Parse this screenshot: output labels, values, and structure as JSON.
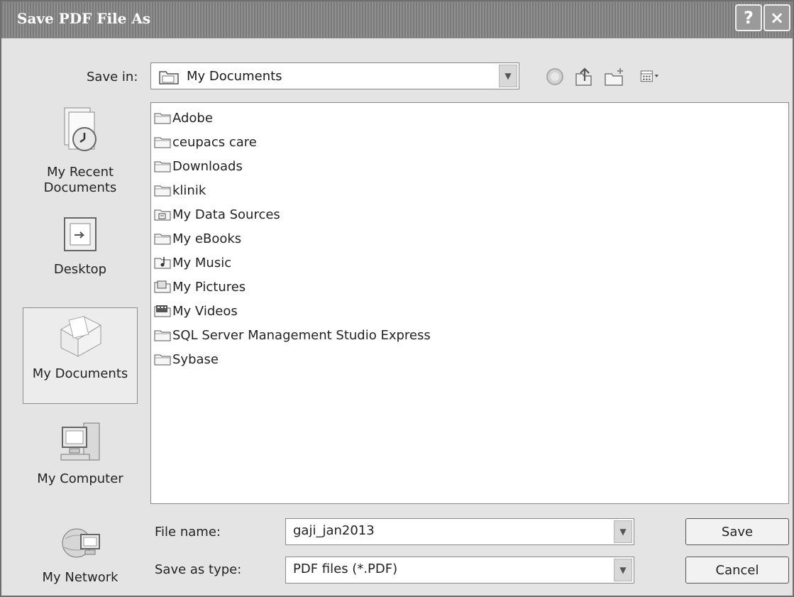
{
  "window": {
    "title": "Save PDF File As",
    "help_label": "?",
    "close_label": "×"
  },
  "save_in": {
    "label": "Save in:",
    "value": "My Documents"
  },
  "toolbar": {
    "icons": [
      "back-icon",
      "up-folder-icon",
      "new-folder-icon",
      "views-menu-icon"
    ]
  },
  "places": [
    {
      "label": "My Recent Documents",
      "line1": "My Recent",
      "line2": "Documents",
      "icon": "recent-documents-icon"
    },
    {
      "label": "Desktop",
      "icon": "desktop-icon"
    },
    {
      "label": "My Documents",
      "icon": "my-documents-icon",
      "selected": true
    },
    {
      "label": "My Computer",
      "icon": "my-computer-icon"
    },
    {
      "label": "My Network",
      "icon": "my-network-icon"
    }
  ],
  "files": [
    {
      "name": "Adobe",
      "icon": "folder-icon"
    },
    {
      "name": "ceupacs care",
      "icon": "folder-icon"
    },
    {
      "name": "Downloads",
      "icon": "folder-icon"
    },
    {
      "name": "klinik",
      "icon": "folder-icon"
    },
    {
      "name": "My Data Sources",
      "icon": "data-sources-folder-icon"
    },
    {
      "name": "My eBooks",
      "icon": "folder-icon"
    },
    {
      "name": "My Music",
      "icon": "music-folder-icon"
    },
    {
      "name": "My Pictures",
      "icon": "pictures-folder-icon"
    },
    {
      "name": "My Videos",
      "icon": "videos-folder-icon"
    },
    {
      "name": "SQL Server Management Studio Express",
      "icon": "folder-icon"
    },
    {
      "name": "Sybase",
      "icon": "folder-icon"
    }
  ],
  "file_name": {
    "label": "File name:",
    "value": "gaji_jan2013"
  },
  "save_as_type": {
    "label": "Save as type:",
    "value": "PDF files (*.PDF)"
  },
  "buttons": {
    "save": "Save",
    "cancel": "Cancel"
  }
}
